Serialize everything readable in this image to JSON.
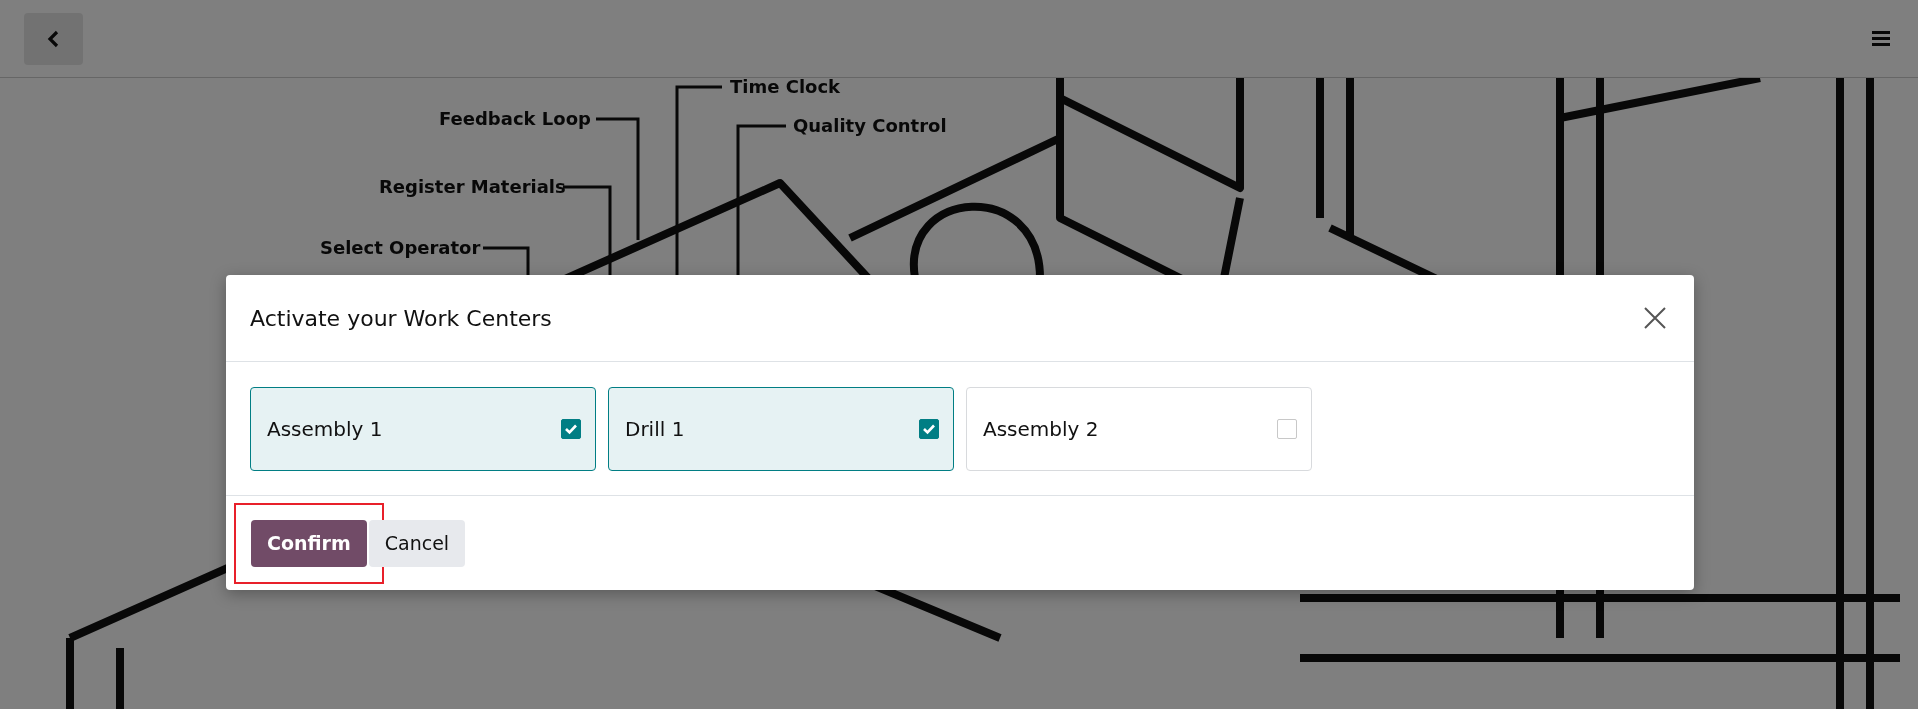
{
  "background": {
    "labels": [
      {
        "text": "Time Clock"
      },
      {
        "text": "Feedback Loop"
      },
      {
        "text": "Quality Control"
      },
      {
        "text": "Register Materials"
      },
      {
        "text": "Select Operator"
      }
    ]
  },
  "dialog": {
    "title": "Activate your Work Centers",
    "options": [
      {
        "label": "Assembly 1",
        "checked": true
      },
      {
        "label": "Drill 1",
        "checked": true
      },
      {
        "label": "Assembly 2",
        "checked": false
      }
    ],
    "buttons": [
      {
        "label": "Confirm",
        "kind": "primary",
        "highlighted": true
      },
      {
        "label": "Cancel",
        "kind": "secondary",
        "highlighted": false
      }
    ]
  }
}
